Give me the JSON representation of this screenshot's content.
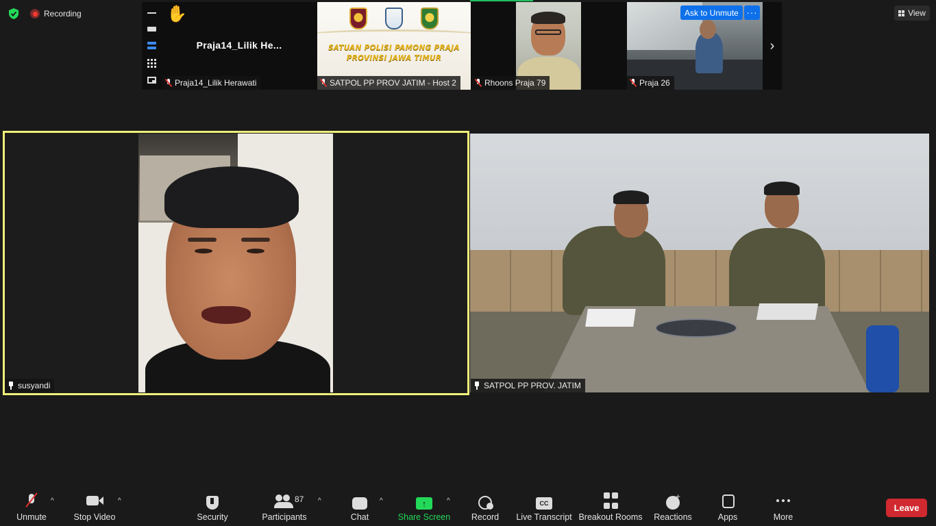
{
  "top_bar": {
    "recording_label": "Recording",
    "view_label": "View"
  },
  "thumbnails": [
    {
      "label": "Praja14_Lilik Herawati",
      "display_name": "Praja14_Lilik  He...",
      "muted": true,
      "raised_hand": true
    },
    {
      "label": "SATPOL PP PROV JATIM - Host 2",
      "muted": true,
      "banner_line1": "SATUAN POLISI PAMONG PRAJA",
      "banner_line2": "PROVINSI JAWA TIMUR"
    },
    {
      "label": "Rhoons Praja 79",
      "muted": true
    },
    {
      "label": "Praja 26",
      "muted": true,
      "ask_button": "Ask to Unmute",
      "more_button": "···"
    }
  ],
  "main_videos": [
    {
      "label": "susyandi",
      "active_speaker": true
    },
    {
      "label": "SATPOL PP PROV. JATIM"
    }
  ],
  "toolbar": {
    "unmute": "Unmute",
    "stop_video": "Stop Video",
    "security": "Security",
    "participants": "Participants",
    "participants_count": "87",
    "chat": "Chat",
    "share_screen": "Share Screen",
    "record": "Record",
    "live_transcript": "Live Transcript",
    "cc": "CC",
    "breakout_rooms": "Breakout Rooms",
    "reactions": "Reactions",
    "apps": "Apps",
    "more": "More",
    "leave": "Leave"
  },
  "colors": {
    "background": "#1a1a1a",
    "active_speaker_border": "#f0f07a",
    "share_green": "#23d959",
    "leave_red": "#d0292f",
    "accent_blue": "#0e71eb"
  }
}
